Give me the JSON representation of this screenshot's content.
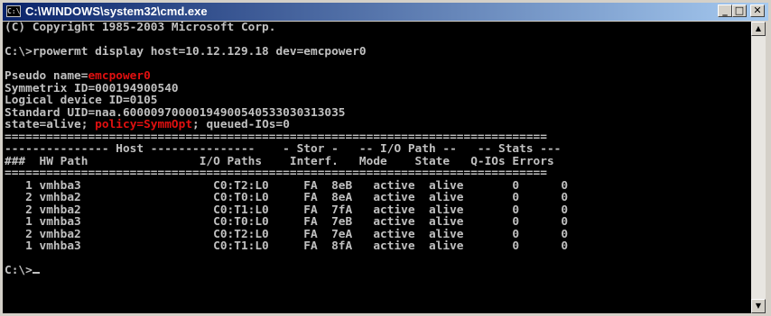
{
  "window": {
    "title": "C:\\WINDOWS\\system32\\cmd.exe",
    "icon": "cmd-icon",
    "buttons": {
      "minimize": "_",
      "maximize": "□",
      "close": "✕"
    }
  },
  "console": {
    "copyright": "(C) Copyright 1985-2003 Microsoft Corp.",
    "command_line": "C:\\>rpowermt display host=10.12.129.18 dev=emcpower0",
    "pseudo_label": "Pseudo name=",
    "pseudo_value": "emcpower0",
    "symmetrix": "Symmetrix ID=000194900540",
    "logical_device": "Logical device ID=0105",
    "standard_uid": "Standard UID=naa.60000970000194900540533030313035",
    "state_prefix": "state=alive; ",
    "policy": "policy=SymmOpt",
    "state_suffix": "; queued-IOs=0",
    "separator": "==============================================================================",
    "header_line1": "--------------- Host ---------------    - Stor -   -- I/O Path --   -- Stats ---",
    "header_line2": "###  HW Path                I/O Paths    Interf.   Mode    State   Q-IOs Errors",
    "rows": [
      "   1 vmhba3                   C0:T2:L0     FA  8eB   active  alive       0      0",
      "   2 vmhba2                   C0:T0:L0     FA  8eA   active  alive       0      0",
      "   2 vmhba2                   C0:T1:L0     FA  7fA   active  alive       0      0",
      "   1 vmhba3                   C0:T0:L0     FA  7eB   active  alive       0      0",
      "   2 vmhba2                   C0:T2:L0     FA  7eA   active  alive       0      0",
      "   1 vmhba3                   C0:T1:L0     FA  8fA   active  alive       0      0"
    ],
    "prompt": "C:\\>"
  },
  "scrollbar": {
    "up": "▲",
    "down": "▼"
  }
}
